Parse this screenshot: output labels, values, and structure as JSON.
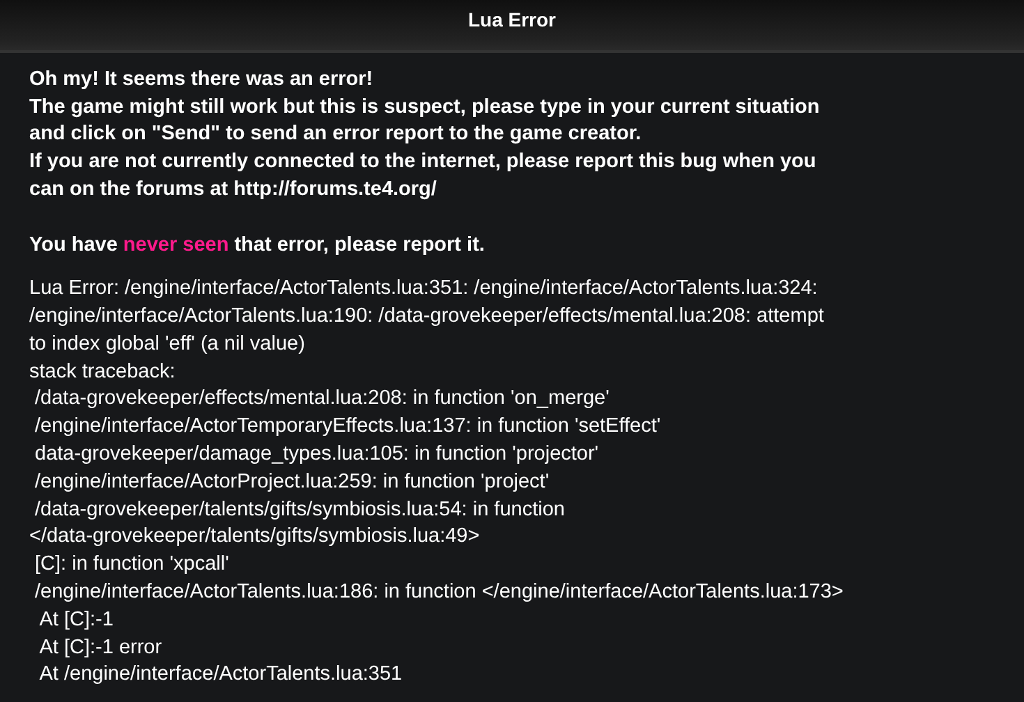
{
  "window": {
    "title": "Lua Error"
  },
  "intro_lines": [
    "Oh my! It seems there was an error!",
    "The game might still work but this is suspect, please type in your current situation",
    "and click on \"Send\" to send an error report to the game creator.",
    "If you are not currently connected to the internet, please report this bug when you",
    "can on the forums at http://forums.te4.org/"
  ],
  "notice": [
    {
      "kind": "plain",
      "text": "You have "
    },
    {
      "kind": "highlight",
      "text": "never seen"
    },
    {
      "kind": "plain",
      "text": " that error, please report it."
    }
  ],
  "error_lines": [
    "Lua Error: /engine/interface/ActorTalents.lua:351: /engine/interface/ActorTalents.lua:324:",
    "/engine/interface/ActorTalents.lua:190: /data-grovekeeper/effects/mental.lua:208: attempt",
    "to index global 'eff' (a nil value)",
    "stack traceback:",
    " /data-grovekeeper/effects/mental.lua:208: in function 'on_merge'",
    " /engine/interface/ActorTemporaryEffects.lua:137: in function 'setEffect'",
    " data-grovekeeper/damage_types.lua:105: in function 'projector'",
    " /engine/interface/ActorProject.lua:259: in function 'project'",
    " /data-grovekeeper/talents/gifts/symbiosis.lua:54: in function",
    "</data-grovekeeper/talents/gifts/symbiosis.lua:49>",
    " [C]: in function 'xpcall'",
    " /engine/interface/ActorTalents.lua:186: in function </engine/interface/ActorTalents.lua:173>",
    "  At [C]:-1",
    "  At [C]:-1 error",
    "  At /engine/interface/ActorTalents.lua:351"
  ]
}
